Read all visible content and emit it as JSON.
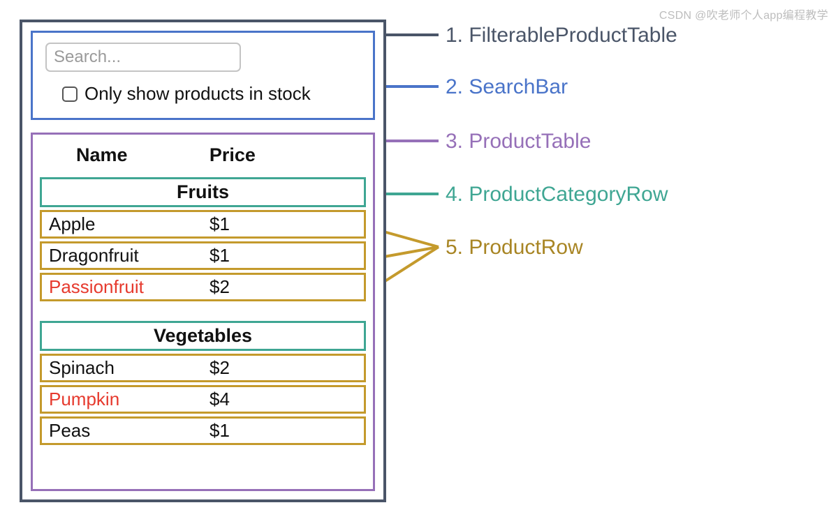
{
  "search": {
    "placeholder": "Search...",
    "stock_label": "Only show products in stock"
  },
  "table": {
    "columns": {
      "name": "Name",
      "price": "Price"
    },
    "categories": [
      {
        "label": "Fruits",
        "rows": [
          {
            "name": "Apple",
            "price": "$1",
            "out_of_stock": false
          },
          {
            "name": "Dragonfruit",
            "price": "$1",
            "out_of_stock": false
          },
          {
            "name": "Passionfruit",
            "price": "$2",
            "out_of_stock": true
          }
        ]
      },
      {
        "label": "Vegetables",
        "rows": [
          {
            "name": "Spinach",
            "price": "$2",
            "out_of_stock": false
          },
          {
            "name": "Pumpkin",
            "price": "$4",
            "out_of_stock": true
          },
          {
            "name": "Peas",
            "price": "$1",
            "out_of_stock": false
          }
        ]
      }
    ]
  },
  "legend": {
    "l1": "1. FilterableProductTable",
    "l2": "2. SearchBar",
    "l3": "3. ProductTable",
    "l4": "4. ProductCategoryRow",
    "l5": "5. ProductRow"
  },
  "colors": {
    "outer": "#4a5568",
    "searchbar": "#4a74c9",
    "producttable": "#9670b8",
    "category": "#3fa693",
    "row": "#c49a2c",
    "out_of_stock": "#e63a2e"
  },
  "watermark": "CSDN @吹老师个人app编程教学"
}
